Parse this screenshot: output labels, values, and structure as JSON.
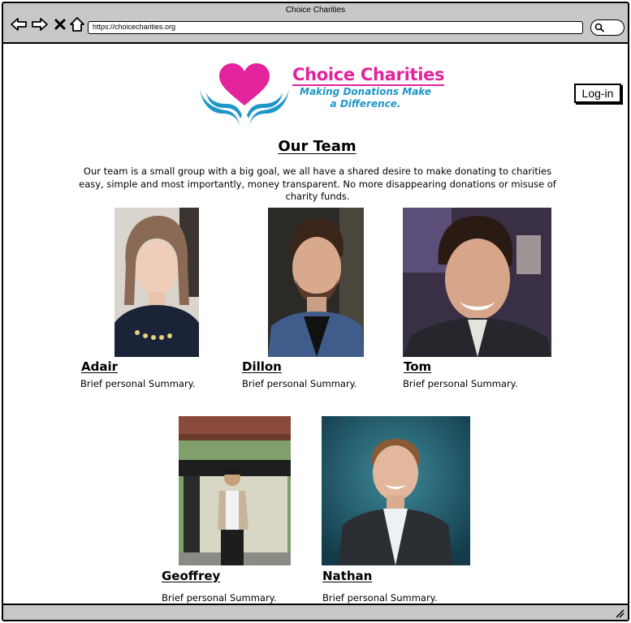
{
  "window": {
    "title": "Choice Charities",
    "url": "https://choicecharities.org"
  },
  "header": {
    "brand_name": "Choice Charities",
    "tagline_line1": "Making Donations Make",
    "tagline_line2": "a Difference.",
    "login_label": "Log-in"
  },
  "page": {
    "title": "Our Team",
    "intro": "Our team is a small group with a big goal, we all have a shared desire to make donating to charities easy, simple and most importantly, money transparent. No more disappearing donations or misuse of charity funds."
  },
  "team": [
    {
      "name": "Adair",
      "summary": "Brief personal Summary."
    },
    {
      "name": "Dillon",
      "summary": "Brief personal Summary."
    },
    {
      "name": "Tom",
      "summary": "Brief personal Summary."
    },
    {
      "name": "Geoffrey",
      "summary": "Brief personal Summary."
    },
    {
      "name": "Nathan",
      "summary": "Brief personal Summary."
    }
  ],
  "colors": {
    "brand_pink": "#e2239b",
    "brand_blue": "#1e96c8",
    "chrome_gray": "#c8c8c8"
  },
  "icons": [
    "back-arrow-icon",
    "forward-arrow-icon",
    "close-icon",
    "home-icon",
    "search-icon",
    "resize-grip-icon"
  ]
}
